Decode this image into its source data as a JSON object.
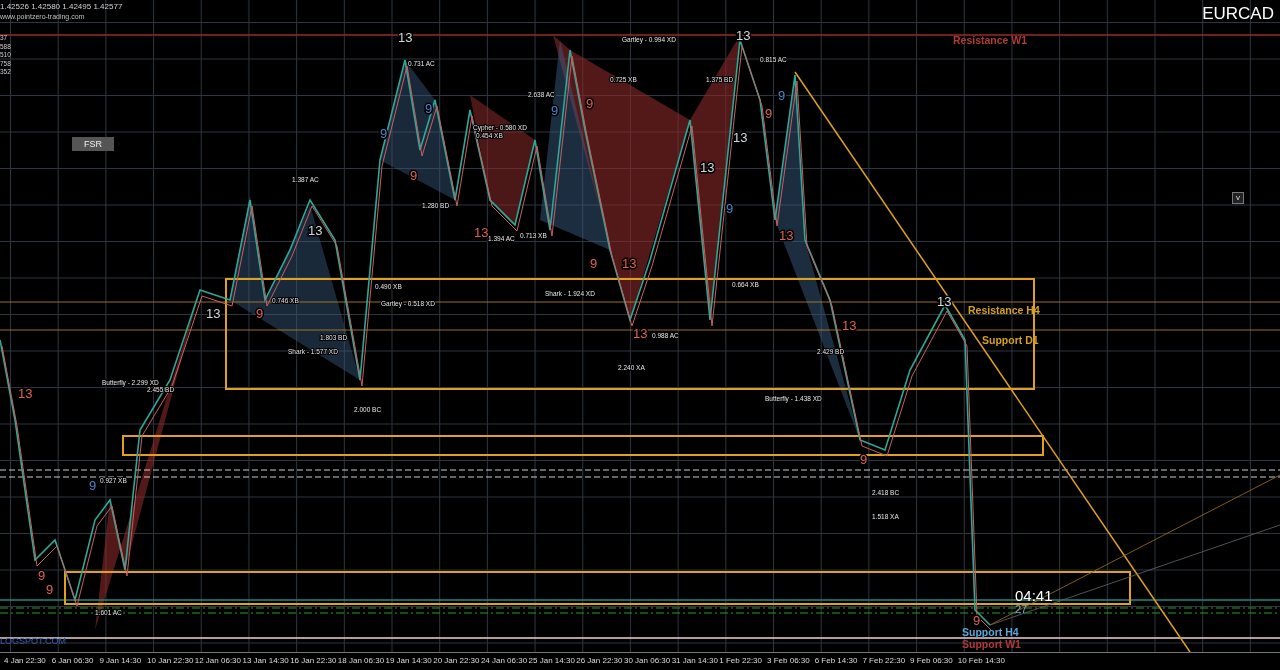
{
  "header": {
    "ohlc": "1.42526 1.42580 1.42495 1.42577",
    "website": "www.pointzero-trading.com"
  },
  "symbol": "EURCAD",
  "fsr_button": "FSR",
  "collapse_button": "v",
  "price_scale_fragments": [
    "37",
    "588",
    "510",
    "758",
    "352"
  ],
  "levels": [
    {
      "label": "Resistance W1",
      "color": "#b03a3a"
    },
    {
      "label": "Resistance H4",
      "color": "#d4a020"
    },
    {
      "label": "Support D1",
      "color": "#d4a020"
    },
    {
      "label": "Support H4",
      "color": "#5aa8d8"
    },
    {
      "label": "Support W1",
      "color": "#b03a3a"
    }
  ],
  "pattern_labels": [
    "Gartley - 0.994 XD",
    "0.731 AC",
    "0.725 XB",
    "1.375 BD",
    "0.815 AC",
    "2.638 AC",
    "Cypher - 0.580 XD",
    "0.454 XB",
    "1.387 AC",
    "1.280 BD",
    "1.394 AC",
    "0.713 XB",
    "0.490 XB",
    "Gartley - 0.518 XD",
    "0.746 XB",
    "1.803 BD",
    "Shark - 1.577 XD",
    "Butterfly - 2.299 XD",
    "2.455 BD",
    "Shark - 1.924 XD",
    "0.988 AC",
    "0.664 XB",
    "2.429 BD",
    "Butterfly - 1.438 XD",
    "2.418 BC",
    "1.518 XA",
    "0.927 XB",
    "1.601 AC",
    "2.000 BC",
    "2.240 XA"
  ],
  "counts": [
    {
      "text": "13",
      "color": "#e06050"
    },
    {
      "text": "9",
      "color": "#e06050"
    },
    {
      "text": "9",
      "color": "#e06050"
    },
    {
      "text": "9",
      "color": "#4a86c8"
    },
    {
      "text": "13",
      "color": "#cfd8dc"
    },
    {
      "text": "9",
      "color": "#e06050"
    },
    {
      "text": "13",
      "color": "#cfd8dc"
    },
    {
      "text": "9",
      "color": "#4a86c8"
    },
    {
      "text": "13",
      "color": "#cfd8dc"
    },
    {
      "text": "9",
      "color": "#e06050"
    },
    {
      "text": "9",
      "color": "#4a86c8"
    },
    {
      "text": "13",
      "color": "#e06050"
    },
    {
      "text": "9",
      "color": "#4a86c8"
    },
    {
      "text": "9",
      "color": "#e06050"
    },
    {
      "text": "9",
      "color": "#e06050"
    },
    {
      "text": "13",
      "color": "#e06050"
    },
    {
      "text": "13",
      "color": "#e06050"
    },
    {
      "text": "13",
      "color": "#cfd8dc"
    },
    {
      "text": "9",
      "color": "#4a86c8"
    },
    {
      "text": "13",
      "color": "#cfd8dc"
    },
    {
      "text": "13",
      "color": "#cfd8dc"
    },
    {
      "text": "9",
      "color": "#e06050"
    },
    {
      "text": "13",
      "color": "#e06050"
    },
    {
      "text": "9",
      "color": "#4a86c8"
    },
    {
      "text": "13",
      "color": "#e06050"
    },
    {
      "text": "9",
      "color": "#e06050"
    },
    {
      "text": "13",
      "color": "#cfd8dc"
    },
    {
      "text": "9",
      "color": "#e06050"
    }
  ],
  "timer": "04:41",
  "spread": "27",
  "footer_text": "LOGSPOT.COM",
  "time_axis": [
    "4 Jan 22:30",
    "6 Jan 06:30",
    "9 Jan 14:30",
    "10 Jan 22:30",
    "12 Jan 06:30",
    "13 Jan 14:30",
    "16 Jan 22:30",
    "18 Jan 06:30",
    "19 Jan 14:30",
    "20 Jan 22:30",
    "24 Jan 06:30",
    "25 Jan 14:30",
    "26 Jan 22:30",
    "30 Jan 06:30",
    "31 Jan 14:30",
    "1 Feb 22:30",
    "3 Feb 06:30",
    "6 Feb 14:30",
    "7 Feb 22:30",
    "9 Feb 06:30",
    "10 Feb 14:30"
  ]
}
